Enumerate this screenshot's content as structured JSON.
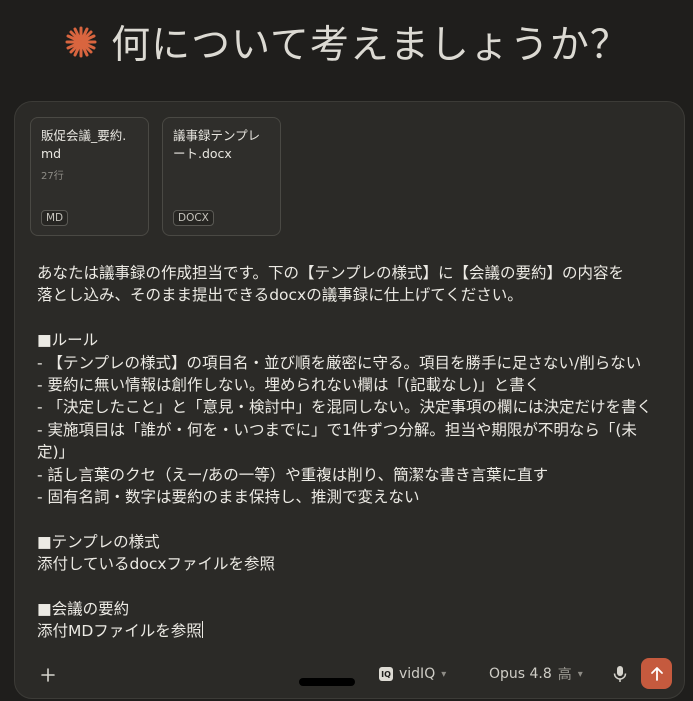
{
  "greeting": "何について考えましょうか？",
  "attachments": [
    {
      "name": "販促会議_要約.md",
      "meta": "27行",
      "badge": "MD"
    },
    {
      "name": "議事録テンプレート.docx",
      "meta": "",
      "badge": "DOCX"
    }
  ],
  "message_lines": [
    "あなたは議事録の作成担当です。下の【テンプレの様式】に【会議の要約】の内容を",
    "落とし込み、そのまま提出できるdocxの議事録に仕上げてください。",
    "",
    "■ルール",
    "- 【テンプレの様式】の項目名・並び順を厳密に守る。項目を勝手に足さない/削らない",
    "- 要約に無い情報は創作しない。埋められない欄は「(記載なし)」と書く",
    "- 「決定したこと」と「意見・検討中」を混同しない。決定事項の欄には決定だけを書く",
    "- 実施項目は「誰が・何を・いつまでに」で1件ずつ分解。担当や期限が不明なら「(未",
    "定)」",
    "- 話し言葉のクセ（えー/あの一等）や重複は削り、簡潔な書き言葉に直す",
    "- 固有名詞・数字は要約のまま保持し、推測で変えない",
    "",
    "■テンプレの様式",
    "添付しているdocxファイルを参照",
    "",
    "■会議の要約",
    "添付MDファイルを参照"
  ],
  "toolbar": {
    "tool_label": "vidIQ",
    "tool_badge": "IQ",
    "model_label": "Opus 4.8",
    "effort_label": "高"
  },
  "colors": {
    "background": "#1f1e1c",
    "composer": "#2b2a27",
    "accent": "#c55a3e"
  }
}
